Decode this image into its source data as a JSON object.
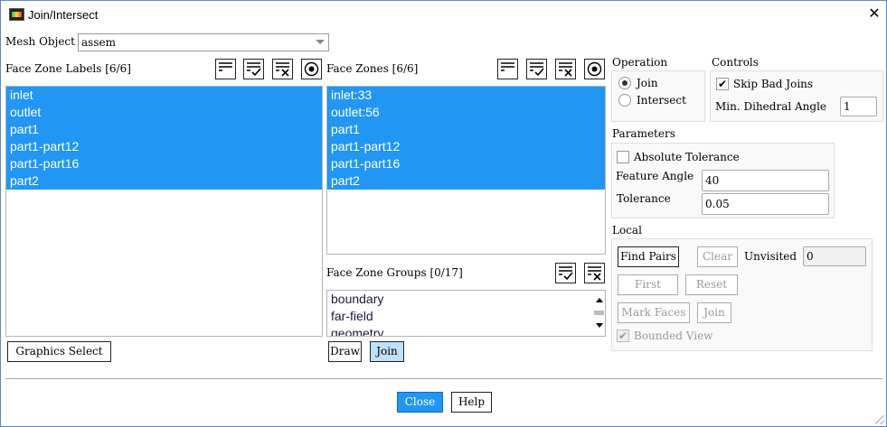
{
  "window": {
    "title": "Join/Intersect"
  },
  "mesh_object": {
    "label": "Mesh Object",
    "value": "assem"
  },
  "face_zone_labels": {
    "title": "Face Zone Labels [6/6]",
    "items": [
      "inlet",
      "outlet",
      "part1",
      "part1-part12",
      "part1-part16",
      "part2"
    ]
  },
  "face_zones": {
    "title": "Face Zones [6/6]",
    "items": [
      "inlet:33",
      "outlet:56",
      "part1",
      "part1-part12",
      "part1-part16",
      "part2"
    ]
  },
  "face_zone_groups": {
    "title": "Face Zone Groups [0/17]",
    "items": [
      "boundary",
      "far-field",
      "geometry"
    ]
  },
  "buttons": {
    "graphics_select": "Graphics Select",
    "draw": "Draw",
    "join": "Join",
    "close": "Close",
    "help": "Help"
  },
  "operation": {
    "title": "Operation",
    "join": "Join",
    "intersect": "Intersect",
    "selected": "Join"
  },
  "controls": {
    "title": "Controls",
    "skip_bad_joins": "Skip Bad Joins",
    "skip_checked": true,
    "min_dihedral_label": "Min. Dihedral Angle",
    "min_dihedral_value": "1"
  },
  "parameters": {
    "title": "Parameters",
    "absolute_tolerance": "Absolute Tolerance",
    "abs_checked": false,
    "feature_angle_label": "Feature Angle",
    "feature_angle_value": "40",
    "tolerance_label": "Tolerance",
    "tolerance_value": "0.05"
  },
  "local": {
    "title": "Local",
    "find_pairs": "Find Pairs",
    "clear": "Clear",
    "unvisited_label": "Unvisited",
    "unvisited_value": "0",
    "first": "First",
    "reset": "Reset",
    "mark_faces": "Mark Faces",
    "join": "Join",
    "bounded_view": "Bounded View"
  },
  "colors": {
    "selection": "#2196f3",
    "accent_button": "#2196f3",
    "join_button": "#bfe0fb"
  }
}
